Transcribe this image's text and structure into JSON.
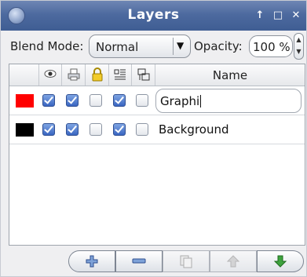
{
  "window": {
    "title": "Layers",
    "controls": [
      {
        "name": "shade-button",
        "glyph": "↑"
      },
      {
        "name": "maximize-button",
        "glyph": "□"
      },
      {
        "name": "close-button",
        "glyph": "✕"
      }
    ]
  },
  "toolbar": {
    "blend_mode_label": "Blend Mode:",
    "blend_mode_value": "Normal",
    "opacity_label": "Opacity:",
    "opacity_value": "100 %"
  },
  "table": {
    "headers": [
      {
        "icon": "visible-eye-icon"
      },
      {
        "icon": "printable-icon"
      },
      {
        "icon": "lock-icon"
      },
      {
        "icon": "flow-text-icon"
      },
      {
        "icon": "outline-icon"
      },
      {
        "label": "Name"
      }
    ],
    "rows": [
      {
        "color": "#ff0000",
        "visible": true,
        "printable": true,
        "locked": false,
        "flow": true,
        "outline": false,
        "name": "Graphi",
        "editing": true
      },
      {
        "color": "#000000",
        "visible": true,
        "printable": true,
        "locked": false,
        "flow": true,
        "outline": false,
        "name": "Background",
        "editing": false
      }
    ]
  },
  "actions": [
    {
      "name": "add-layer",
      "icon": "plus-icon",
      "enabled": true
    },
    {
      "name": "delete-layer",
      "icon": "minus-icon",
      "enabled": true
    },
    {
      "name": "duplicate-layer",
      "icon": "duplicate-icon",
      "enabled": false
    },
    {
      "name": "raise-layer",
      "icon": "arrow-up-icon",
      "enabled": false
    },
    {
      "name": "lower-layer",
      "icon": "arrow-down-icon",
      "enabled": true
    }
  ],
  "colors": {
    "titlebar": "#4d6a9f",
    "checkbox_on": "#3a66c1",
    "arrow_down": "#3ea33e"
  }
}
